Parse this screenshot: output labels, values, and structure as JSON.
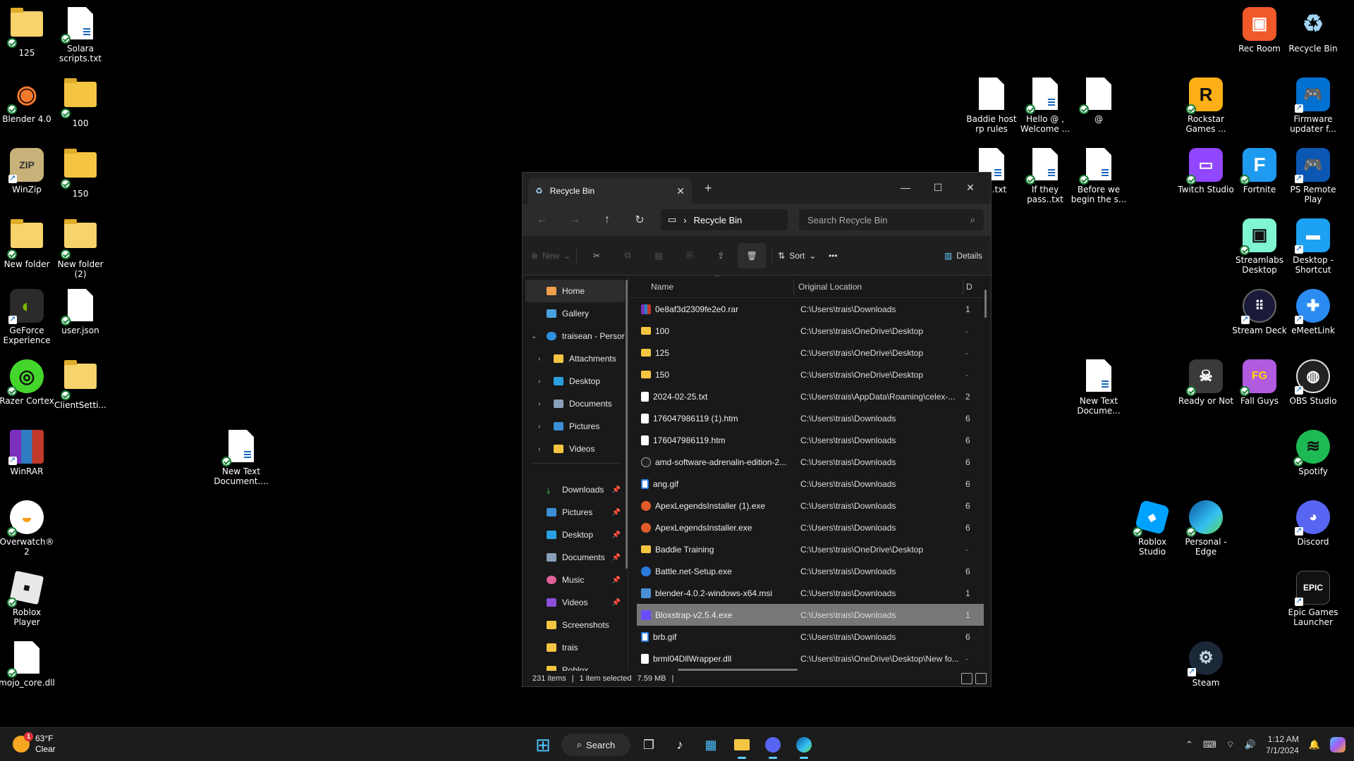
{
  "desktop": {
    "left_icons": [
      {
        "label": "125"
      },
      {
        "label": "Solara scripts.txt"
      },
      {
        "label": "Blender 4.0"
      },
      {
        "label": "100"
      },
      {
        "label": "WinZip"
      },
      {
        "label": "150"
      },
      {
        "label": "New folder"
      },
      {
        "label": "New folder (2)"
      },
      {
        "label": "GeForce Experience"
      },
      {
        "label": "user.json"
      },
      {
        "label": "Razer Cortex"
      },
      {
        "label": "ClientSetti..."
      },
      {
        "label": "WinRAR"
      },
      {
        "label": "New Text Document...."
      },
      {
        "label": "Overwatch® 2"
      },
      {
        "label": "Roblox Player"
      },
      {
        "label": "mojo_core.dll"
      }
    ],
    "right_icons": [
      {
        "label": "Rec Room"
      },
      {
        "label": "Recycle Bin"
      },
      {
        "label": "Baddie host rp rules"
      },
      {
        "label": "Hello @ , Welcome ..."
      },
      {
        "label": "@"
      },
      {
        "label": "Rockstar Games ..."
      },
      {
        "label": "Firmware updater f..."
      },
      {
        "label": "fail..txt"
      },
      {
        "label": "If they pass..txt"
      },
      {
        "label": "Before we begin the s..."
      },
      {
        "label": "Twitch Studio"
      },
      {
        "label": "Fortnite"
      },
      {
        "label": "PS Remote Play"
      },
      {
        "label": "Streamlabs Desktop"
      },
      {
        "label": "Desktop - Shortcut"
      },
      {
        "label": "Stream Deck"
      },
      {
        "label": "eMeetLink"
      },
      {
        "label": "New Text Docume..."
      },
      {
        "label": "Ready or Not"
      },
      {
        "label": "Fall Guys"
      },
      {
        "label": "OBS Studio"
      },
      {
        "label": "Spotify"
      },
      {
        "label": "Roblox Studio"
      },
      {
        "label": "Personal - Edge"
      },
      {
        "label": "Discord"
      },
      {
        "label": "Epic Games Launcher"
      },
      {
        "label": "Steam"
      }
    ]
  },
  "explorer": {
    "tab_title": "Recycle Bin",
    "new_tab": "+",
    "breadcrumb": "Recycle Bin",
    "search_placeholder": "Search Recycle Bin",
    "toolbar": {
      "new": "New",
      "sort": "Sort",
      "more": "•••",
      "details": "Details"
    },
    "nav": [
      {
        "label": "Home",
        "selected": true
      },
      {
        "label": "Gallery"
      },
      {
        "label": "traisean - Persor"
      },
      {
        "label": "Attachments"
      },
      {
        "label": "Desktop"
      },
      {
        "label": "Documents"
      },
      {
        "label": "Pictures"
      },
      {
        "label": "Videos"
      },
      {
        "label": "Downloads"
      },
      {
        "label": "Pictures"
      },
      {
        "label": "Desktop"
      },
      {
        "label": "Documents"
      },
      {
        "label": "Music"
      },
      {
        "label": "Videos"
      },
      {
        "label": "Screenshots"
      },
      {
        "label": "trais"
      },
      {
        "label": "Roblox"
      }
    ],
    "columns": {
      "name": "Name",
      "location": "Original Location",
      "date": "D"
    },
    "files": [
      {
        "name": "0e8af3d2309fe2e0.rar",
        "location": "C:\\Users\\trais\\Downloads",
        "d": "1",
        "icon": "rar-i"
      },
      {
        "name": "100",
        "location": "C:\\Users\\trais\\OneDrive\\Desktop",
        "d": "·",
        "icon": "folder-i"
      },
      {
        "name": "125",
        "location": "C:\\Users\\trais\\OneDrive\\Desktop",
        "d": "·",
        "icon": "folder-i"
      },
      {
        "name": "150",
        "location": "C:\\Users\\trais\\OneDrive\\Desktop",
        "d": "·",
        "icon": "folder-i"
      },
      {
        "name": "2024-02-25.txt",
        "location": "C:\\Users\\trais\\AppData\\Roaming\\celex-...",
        "d": "2",
        "icon": "file-i"
      },
      {
        "name": "176047986119 (1).htm",
        "location": "C:\\Users\\trais\\Downloads",
        "d": "6",
        "icon": "file-i"
      },
      {
        "name": "176047986119.htm",
        "location": "C:\\Users\\trais\\Downloads",
        "d": "6",
        "icon": "file-i"
      },
      {
        "name": "amd-software-adrenalin-edition-2...",
        "location": "C:\\Users\\trais\\Downloads",
        "d": "6",
        "icon": "amd-i"
      },
      {
        "name": "ang.gif",
        "location": "C:\\Users\\trais\\Downloads",
        "d": "6",
        "icon": "gif-i"
      },
      {
        "name": "ApexLegendsInstaller (1).exe",
        "location": "C:\\Users\\trais\\Downloads",
        "d": "6",
        "icon": "exe-i"
      },
      {
        "name": "ApexLegendsInstaller.exe",
        "location": "C:\\Users\\trais\\Downloads",
        "d": "6",
        "icon": "exe-i"
      },
      {
        "name": "Baddie Training",
        "location": "C:\\Users\\trais\\OneDrive\\Desktop",
        "d": "·",
        "icon": "folder-i"
      },
      {
        "name": "Battle.net-Setup.exe",
        "location": "C:\\Users\\trais\\Downloads",
        "d": "6",
        "icon": "blue-i"
      },
      {
        "name": "blender-4.0.2-windows-x64.msi",
        "location": "C:\\Users\\trais\\Downloads",
        "d": "1",
        "icon": "msi-i"
      },
      {
        "name": "Bloxstrap-v2.5.4.exe",
        "location": "C:\\Users\\trais\\Downloads",
        "d": "1",
        "icon": "blox-i",
        "selected": true
      },
      {
        "name": "brb.gif",
        "location": "C:\\Users\\trais\\Downloads",
        "d": "6",
        "icon": "gif-i"
      },
      {
        "name": "brml04DllWrapper.dll",
        "location": "C:\\Users\\trais\\OneDrive\\Desktop\\New fo...",
        "d": "·",
        "icon": "dll-i"
      }
    ],
    "status": {
      "count": "231 items",
      "selected": "1 item selected",
      "size": "7.59 MB"
    }
  },
  "taskbar": {
    "weather_temp": "63°F",
    "weather_desc": "Clear",
    "weather_badge": "1",
    "search_label": "Search",
    "time": "1:12 AM",
    "date": "7/1/2024"
  },
  "colors": {
    "accent": "#60cdff",
    "selection": "#777777",
    "folder": "#f5c542"
  }
}
